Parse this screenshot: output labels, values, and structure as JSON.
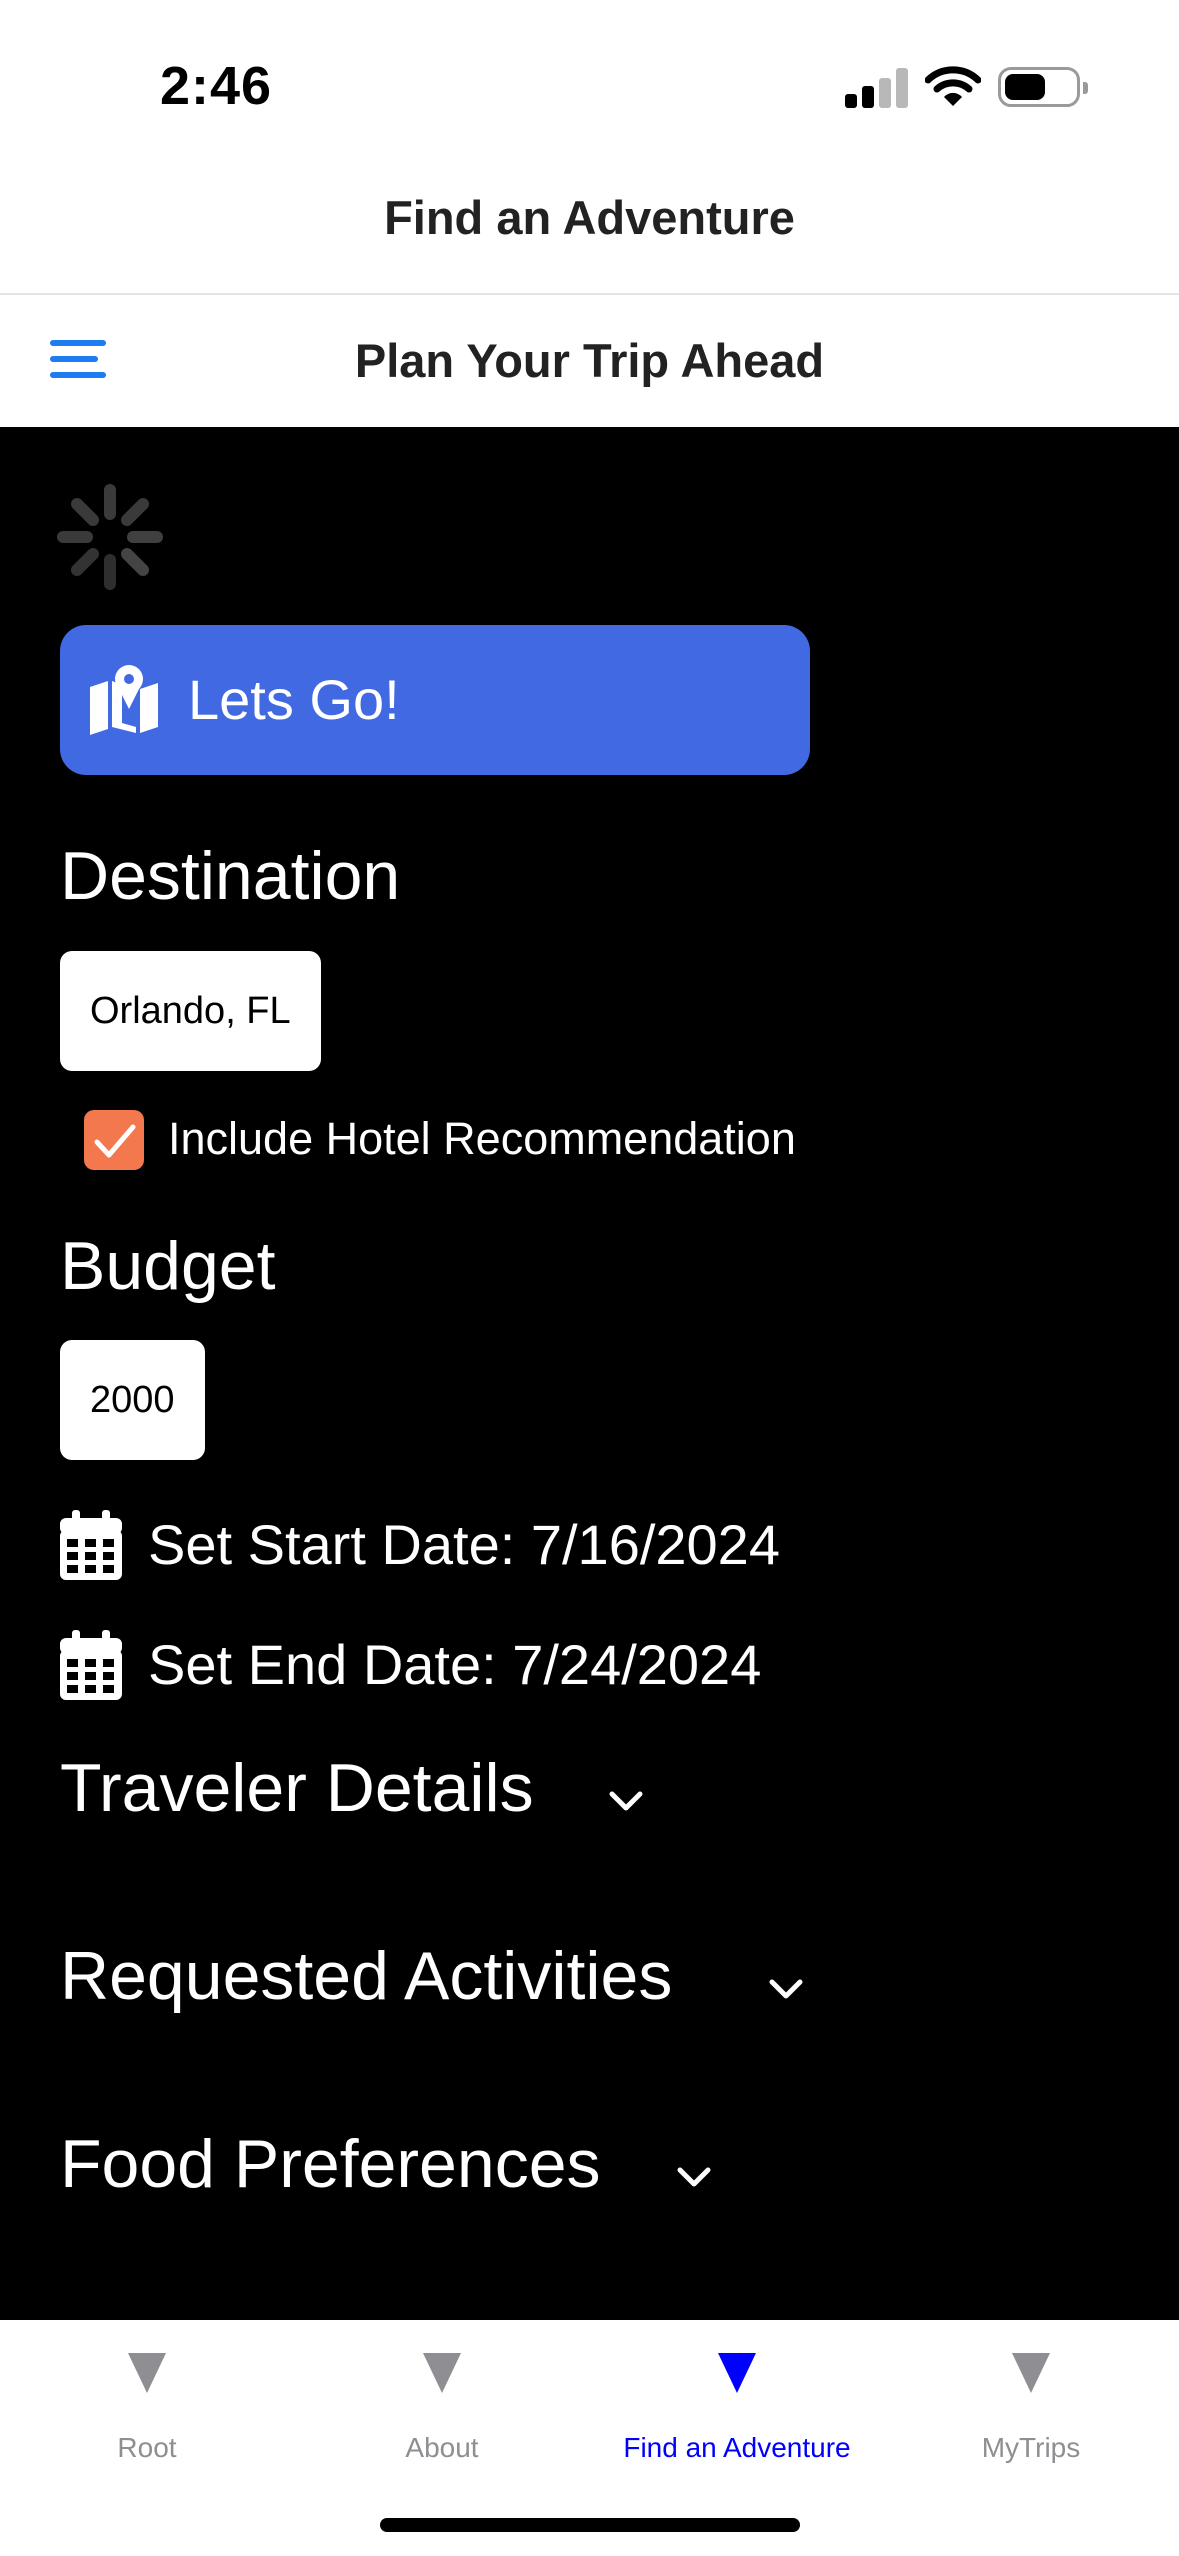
{
  "status_bar": {
    "time": "2:46"
  },
  "nav": {
    "title": "Find an Adventure"
  },
  "header": {
    "title": "Plan Your Trip Ahead"
  },
  "main": {
    "go_button_label": "Lets Go!",
    "destination": {
      "label": "Destination",
      "value": "Orlando, FL"
    },
    "hotel_checkbox": {
      "label": "Include Hotel Recommendation",
      "checked": true,
      "color": "#f4784d"
    },
    "budget": {
      "label": "Budget",
      "value": "2000"
    },
    "start_date": "Set Start Date: 7/16/2024",
    "end_date": "Set End Date: 7/24/2024",
    "sections": [
      {
        "label": "Traveler Details"
      },
      {
        "label": "Requested Activities"
      },
      {
        "label": "Food Preferences"
      }
    ]
  },
  "tabs": [
    {
      "label": "Root",
      "active": false
    },
    {
      "label": "About",
      "active": false
    },
    {
      "label": "Find an Adventure",
      "active": true
    },
    {
      "label": "MyTrips",
      "active": false
    }
  ],
  "colors": {
    "accent_blue": "#1e7cf2",
    "button_blue": "#4169e1",
    "active_tab": "#0000ff",
    "inactive_tab": "#8e8e93",
    "checkbox_orange": "#f4784d",
    "content_bg": "#000000"
  },
  "icons": {
    "menu": "hamburger-icon",
    "spinner": "loading-spinner-icon",
    "button": "map-icon",
    "date": "calendar-icon",
    "accordion": "chevron-down-icon",
    "tab": "triangle-icon"
  }
}
